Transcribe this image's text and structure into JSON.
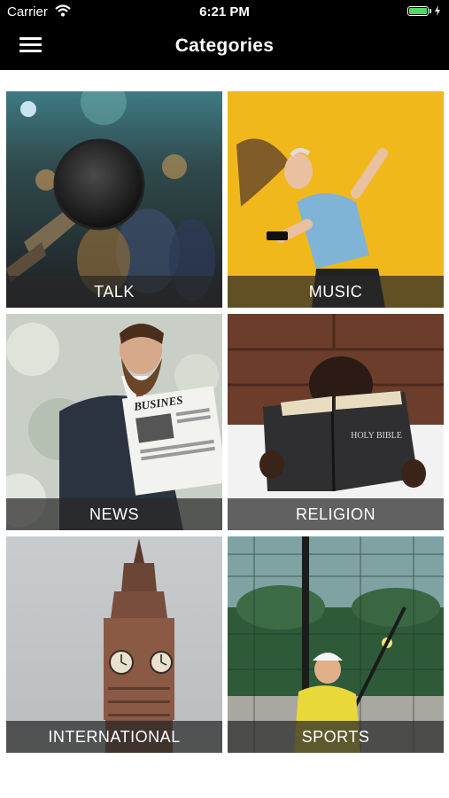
{
  "status_bar": {
    "carrier": "Carrier",
    "time": "6:21 PM"
  },
  "header": {
    "title": "Categories"
  },
  "categories": [
    {
      "label": "TALK"
    },
    {
      "label": "MUSIC"
    },
    {
      "label": "NEWS"
    },
    {
      "label": "RELIGION"
    },
    {
      "label": "INTERNATIONAL"
    },
    {
      "label": "SPORTS"
    }
  ],
  "images": {
    "newspaper_headline": "BUSINES",
    "book_title": "HOLY BIBLE"
  }
}
